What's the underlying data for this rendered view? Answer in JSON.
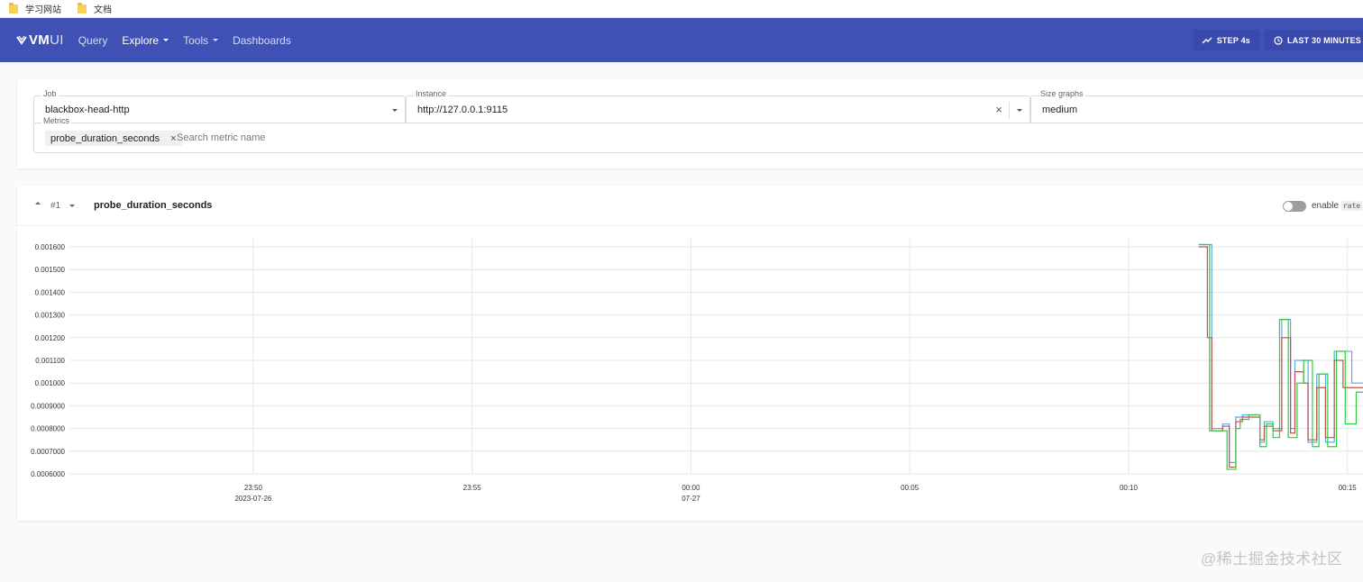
{
  "bookmarks": [
    {
      "label": "学习网站"
    },
    {
      "label": "文档"
    }
  ],
  "header": {
    "logo_vm": "VM",
    "logo_ui": "UI",
    "nav": [
      {
        "label": "Query"
      },
      {
        "label": "Explore"
      },
      {
        "label": "Tools"
      },
      {
        "label": "Dashboards"
      }
    ],
    "step_label": "STEP 4s",
    "time_label": "LAST 30 MINUTES"
  },
  "filters": {
    "job": {
      "label": "Job",
      "value": "blackbox-head-http"
    },
    "instance": {
      "label": "Instance",
      "value": "http://127.0.0.1:9115",
      "clear_icon": "×"
    },
    "size": {
      "label": "Size graphs",
      "value": "medium"
    },
    "metrics": {
      "label": "Metrics",
      "chip": "probe_duration_seconds",
      "chip_remove": "×",
      "placeholder": "Search metric name"
    }
  },
  "graph": {
    "index": "#1",
    "title": "probe_duration_seconds",
    "enable_label": "enable",
    "enable_code": "rate"
  },
  "colors": {
    "header": "#3f51b5",
    "series_blue": "#5ba9e6",
    "series_red": "#c0504d",
    "series_green": "#2ecc40"
  },
  "chart_data": {
    "type": "line",
    "ylim": [
      0.0006,
      0.0016
    ],
    "y_ticks": [
      "0.001600",
      "0.001500",
      "0.001400",
      "0.001300",
      "0.001200",
      "0.001100",
      "0.001000",
      "0.0009000",
      "0.0008000",
      "0.0007000",
      "0.0006000"
    ],
    "x_ticks": [
      {
        "time": "23:50",
        "date": "2023-07-26"
      },
      {
        "time": "23:55",
        "date": ""
      },
      {
        "time": "00:00",
        "date": "07-27"
      },
      {
        "time": "00:05",
        "date": ""
      },
      {
        "time": "00:10",
        "date": ""
      },
      {
        "time": "00:15",
        "date": ""
      }
    ],
    "x_minutes": [
      0,
      5,
      10,
      15,
      20,
      25
    ],
    "xlim_minutes": [
      -4.2,
      25.5
    ],
    "series": [
      {
        "color": "#5ba9e6",
        "x": [
          21.6,
          21.85,
          21.9,
          22.15,
          22.3,
          22.45,
          22.6,
          22.75,
          23.0,
          23.1,
          23.3,
          23.5,
          23.7,
          23.8,
          24.0,
          24.1,
          24.3,
          24.5,
          24.7,
          24.9,
          25.1,
          25.5
        ],
        "y": [
          0.00161,
          0.00161,
          0.0008,
          0.00082,
          0.00065,
          0.00085,
          0.00086,
          0.00086,
          0.00074,
          0.00083,
          0.0008,
          0.00128,
          0.0008,
          0.0011,
          0.0011,
          0.00074,
          0.00104,
          0.00074,
          0.00114,
          0.00114,
          0.001,
          0.00105
        ]
      },
      {
        "color": "#c0504d",
        "x": [
          21.6,
          21.8,
          21.9,
          22.15,
          22.3,
          22.45,
          22.6,
          22.75,
          23.0,
          23.1,
          23.3,
          23.5,
          23.7,
          23.8,
          24.0,
          24.1,
          24.3,
          24.5,
          24.7,
          24.9,
          25.1,
          25.5
        ],
        "y": [
          0.0016,
          0.0012,
          0.00079,
          0.00081,
          0.00063,
          0.00083,
          0.00085,
          0.00085,
          0.00075,
          0.00081,
          0.00079,
          0.0012,
          0.00078,
          0.00105,
          0.001,
          0.00075,
          0.00098,
          0.00076,
          0.0011,
          0.00098,
          0.00098,
          0.00098
        ]
      },
      {
        "color": "#2ecc40",
        "x": [
          21.6,
          21.75,
          21.85,
          22.1,
          22.25,
          22.45,
          22.55,
          22.75,
          23.0,
          23.15,
          23.3,
          23.45,
          23.65,
          23.85,
          24.0,
          24.2,
          24.35,
          24.55,
          24.75,
          24.95,
          25.2,
          25.5
        ],
        "y": [
          0.00161,
          0.00161,
          0.00079,
          0.00079,
          0.00062,
          0.0008,
          0.00084,
          0.00086,
          0.00072,
          0.00082,
          0.00076,
          0.00128,
          0.00076,
          0.001,
          0.0011,
          0.00072,
          0.00104,
          0.00072,
          0.00114,
          0.00082,
          0.00096,
          0.00082
        ]
      }
    ]
  },
  "watermark": "@稀土掘金技术社区"
}
